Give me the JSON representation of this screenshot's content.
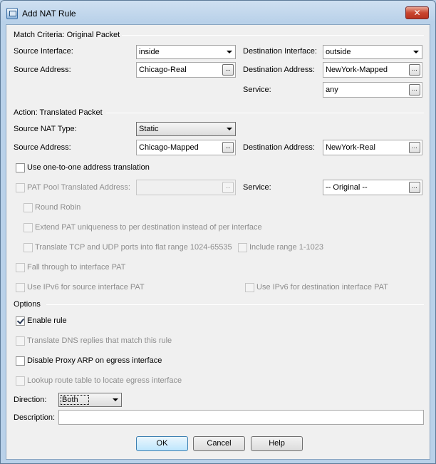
{
  "window": {
    "title": "Add NAT Rule",
    "close_glyph": "✕"
  },
  "match_section": {
    "title": "Match Criteria: Original Packet",
    "source_interface_label": "Source Interface:",
    "source_interface_value": "inside",
    "destination_interface_label": "Destination Interface:",
    "destination_interface_value": "outside",
    "source_address_label": "Source Address:",
    "source_address_value": "Chicago-Real",
    "destination_address_label": "Destination Address:",
    "destination_address_value": "NewYork-Mapped",
    "service_label": "Service:",
    "service_value": "any"
  },
  "action_section": {
    "title": "Action: Translated Packet",
    "source_nat_type_label": "Source NAT Type:",
    "source_nat_type_value": "Static",
    "source_address_label": "Source Address:",
    "source_address_value": "Chicago-Mapped",
    "destination_address_label": "Destination Address:",
    "destination_address_value": "NewYork-Real",
    "one_to_one_label": "Use one-to-one address translation",
    "pat_pool_label": "PAT Pool Translated Address:",
    "pat_pool_value": "",
    "service_label": "Service:",
    "service_value": "-- Original --",
    "round_robin_label": "Round Robin",
    "extend_pat_label": "Extend PAT uniqueness to per destination instead of per interface",
    "translate_tcp_udp_label": "Translate TCP and UDP ports into flat range 1024-65535",
    "include_range_label": "Include range 1-1023",
    "fall_through_label": "Fall through to interface PAT",
    "ipv6_source_label": "Use IPv6 for source interface PAT",
    "ipv6_destination_label": "Use IPv6 for destination interface PAT"
  },
  "options_section": {
    "title": "Options",
    "enable_rule_label": "Enable rule",
    "translate_dns_label": "Translate DNS replies that match this rule",
    "disable_proxy_arp_label": "Disable Proxy ARP on egress interface",
    "lookup_route_label": "Lookup route table to locate egress interface",
    "direction_label": "Direction:",
    "direction_value": "Both",
    "description_label": "Description:",
    "description_value": ""
  },
  "checkbox_states": {
    "one_to_one": false,
    "pat_pool": false,
    "round_robin": false,
    "extend_pat": false,
    "translate_tcp_udp": false,
    "include_range": false,
    "fall_through": false,
    "ipv6_source": false,
    "ipv6_destination": false,
    "enable_rule": true,
    "translate_dns": false,
    "disable_proxy_arp": false,
    "lookup_route": false
  },
  "buttons": {
    "ok": "OK",
    "cancel": "Cancel",
    "help": "Help",
    "browse_glyph": "..."
  }
}
